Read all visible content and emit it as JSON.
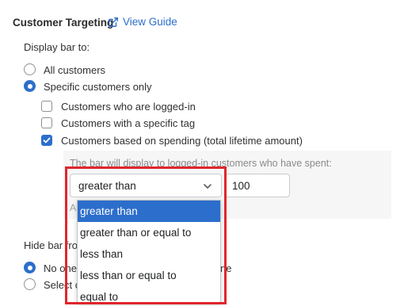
{
  "section": {
    "title": "Customer Targeting",
    "guide_link": "View Guide"
  },
  "display_bar": {
    "label": "Display bar to:",
    "options": [
      {
        "label": "All customers",
        "checked": false
      },
      {
        "label": "Specific customers only",
        "checked": true
      }
    ],
    "criteria": [
      {
        "label": "Customers who are logged-in",
        "checked": false
      },
      {
        "label": "Customers with a specific tag",
        "checked": false
      },
      {
        "label": "Customers based on spending (total lifetime amount)",
        "checked": true
      }
    ]
  },
  "spending": {
    "helper": "The bar will display to logged-in customers who have spent:",
    "select_value": "greater than",
    "amount": "100",
    "partial_note": "An"
  },
  "dropdown": {
    "options": [
      "greater than",
      "greater than or equal to",
      "less than",
      "less than or equal to",
      "equal to"
    ],
    "selected_index": 0
  },
  "hide_bar": {
    "label_partial": "Hide bar fro",
    "options": [
      {
        "label_partial": "No one",
        "checked": true
      },
      {
        "label_partial": "Select c",
        "checked": false
      }
    ],
    "trailing_partial": "ne"
  },
  "colors": {
    "accent": "#2c6ecb",
    "highlight_box": "#e0262c"
  }
}
